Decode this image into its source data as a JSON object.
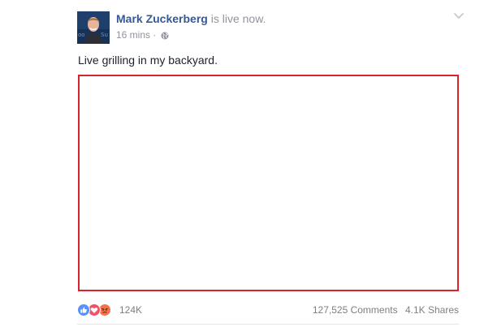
{
  "post": {
    "author": {
      "name": "Mark Zuckerberg",
      "status": "is live now.",
      "avatar_icon": "profile-photo"
    },
    "meta": {
      "timestamp": "16 mins",
      "separator": "·",
      "audience_icon": "globe-icon"
    },
    "message": "Live grilling in my backyard.",
    "video": {
      "border_color": "#d9232d"
    },
    "reactions": {
      "icons": [
        "like-icon",
        "love-icon",
        "angry-icon"
      ],
      "count": "124K"
    },
    "comments_count": "127,525 Comments",
    "shares_count": "4.1K Shares"
  },
  "colors": {
    "link_blue": "#365899",
    "meta_gray": "#90949c",
    "like_blue": "#5890ff",
    "love_red": "#f25268",
    "angry_orange": "#f7714c"
  }
}
